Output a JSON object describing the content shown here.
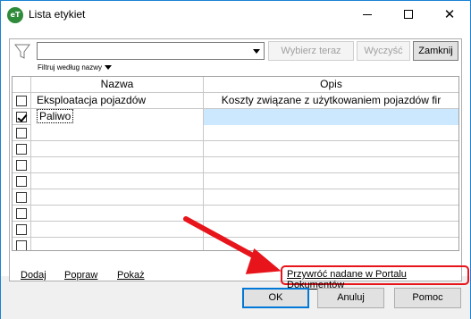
{
  "window": {
    "title": "Lista etykiet",
    "app_icon_text": "eT"
  },
  "filter": {
    "combo_value": "",
    "label": "Filtruj według nazwy",
    "buttons": {
      "select_now": "Wybierz teraz",
      "clear": "Wyczyść",
      "close": "Zamknij"
    }
  },
  "grid": {
    "columns": [
      "Nazwa",
      "Opis"
    ],
    "rows": [
      {
        "checked": false,
        "name": "Eksploatacja pojazdów",
        "description": "Koszty związane z użytkowaniem pojazdów fir",
        "selected": false
      },
      {
        "checked": true,
        "name": "Paliwo",
        "description": "",
        "selected": true
      },
      {
        "checked": false,
        "name": "",
        "description": "",
        "selected": false
      },
      {
        "checked": false,
        "name": "",
        "description": "",
        "selected": false
      },
      {
        "checked": false,
        "name": "",
        "description": "",
        "selected": false
      },
      {
        "checked": false,
        "name": "",
        "description": "",
        "selected": false
      },
      {
        "checked": false,
        "name": "",
        "description": "",
        "selected": false
      },
      {
        "checked": false,
        "name": "",
        "description": "",
        "selected": false
      },
      {
        "checked": false,
        "name": "",
        "description": "",
        "selected": false
      },
      {
        "checked": false,
        "name": "",
        "description": "",
        "selected": false
      }
    ]
  },
  "links": {
    "add": "Dodaj",
    "edit": "Popraw",
    "show": "Pokaż",
    "restore": "Przywróć nadane w Portalu Dokumentów"
  },
  "dialog_buttons": {
    "ok": "OK",
    "cancel": "Anuluj",
    "help": "Pomoc"
  },
  "colors": {
    "selection": "#cce8ff",
    "highlight": "#e8141b",
    "window_border": "#1883d7",
    "app_icon": "#2e8b3a"
  },
  "icons": {
    "filter": "funnel-icon",
    "minimize": "minimize-icon",
    "maximize": "maximize-icon",
    "close": "close-icon"
  }
}
